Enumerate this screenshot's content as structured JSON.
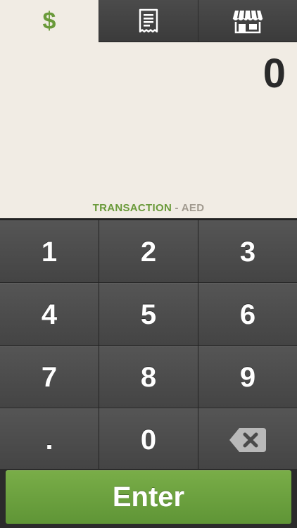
{
  "tabs": {
    "amount": {
      "glyph": "$",
      "icon": "dollar-icon",
      "color": "#6a9a3a",
      "active": true
    },
    "receipt": {
      "icon": "receipt-icon",
      "active": false
    },
    "store": {
      "icon": "store-icon",
      "active": false
    }
  },
  "display": {
    "amount": "0",
    "transaction_label": "TRANSACTION",
    "separator": " - ",
    "currency": "AED"
  },
  "keypad": {
    "keys": [
      "1",
      "2",
      "3",
      "4",
      "5",
      "6",
      "7",
      "8",
      "9",
      ".",
      "0"
    ],
    "backspace_icon": "backspace-icon"
  },
  "enter": {
    "label": "Enter",
    "color": "#6a9f3c"
  },
  "colors": {
    "display_bg": "#f1ece4",
    "accent_green": "#6a9a3a",
    "key_bg": "#4a4a4a",
    "amount_text": "#2a2a2a"
  }
}
